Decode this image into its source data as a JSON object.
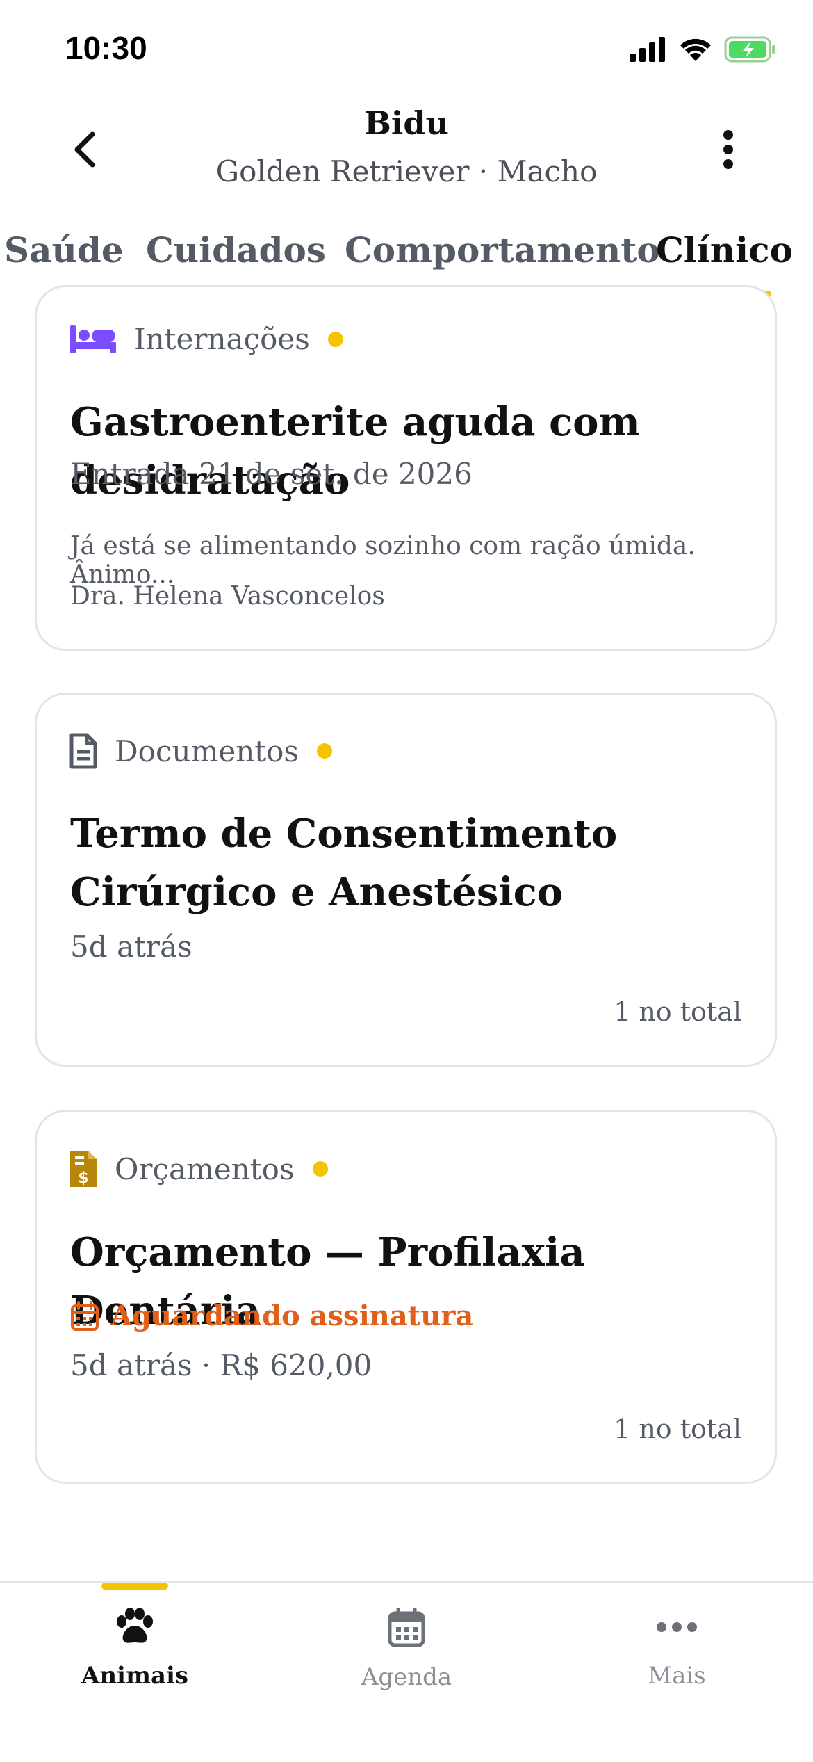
{
  "status_bar": {
    "time": "10:30"
  },
  "header": {
    "title": "Bidu",
    "subtitle": "Golden Retriever · Macho"
  },
  "tabs": [
    {
      "label": "Saúde",
      "active": false
    },
    {
      "label": "Cuidados",
      "active": false
    },
    {
      "label": "Comportamento",
      "active": false
    },
    {
      "label": "Clínico",
      "active": true
    }
  ],
  "cards": {
    "internacoes": {
      "category": "Internações",
      "icon": "bed-icon",
      "icon_color": "#7c4dff",
      "title": "Gastroenterite aguda com desidratação",
      "subtitle": "Entrada 21 de set. de 2026",
      "note": "Já está se alimentando sozinho com ração úmida. Ânimo...",
      "doctor": "Dra. Helena Vasconcelos"
    },
    "documentos": {
      "category": "Documentos",
      "icon": "document-icon",
      "title": "Termo de Consentimento Cirúrgico e Anestésico",
      "subtitle": "5d atrás",
      "total": "1 no total"
    },
    "orcamentos": {
      "category": "Orçamentos",
      "icon": "invoice-icon",
      "icon_color": "#b8860b",
      "title": "Orçamento — Profilaxia Dentária",
      "status": "Aguardando assinatura",
      "status_color": "#e0601a",
      "subtitle": "5d atrás · R$ 620,00",
      "total": "1 no total"
    }
  },
  "bottom_nav": [
    {
      "label": "Animais",
      "icon": "paw-icon",
      "active": true
    },
    {
      "label": "Agenda",
      "icon": "calendar-icon",
      "active": false
    },
    {
      "label": "Mais",
      "icon": "more-horizontal-icon",
      "active": false
    }
  ],
  "colors": {
    "accent": "#f5c400",
    "text_muted": "#555b66"
  }
}
